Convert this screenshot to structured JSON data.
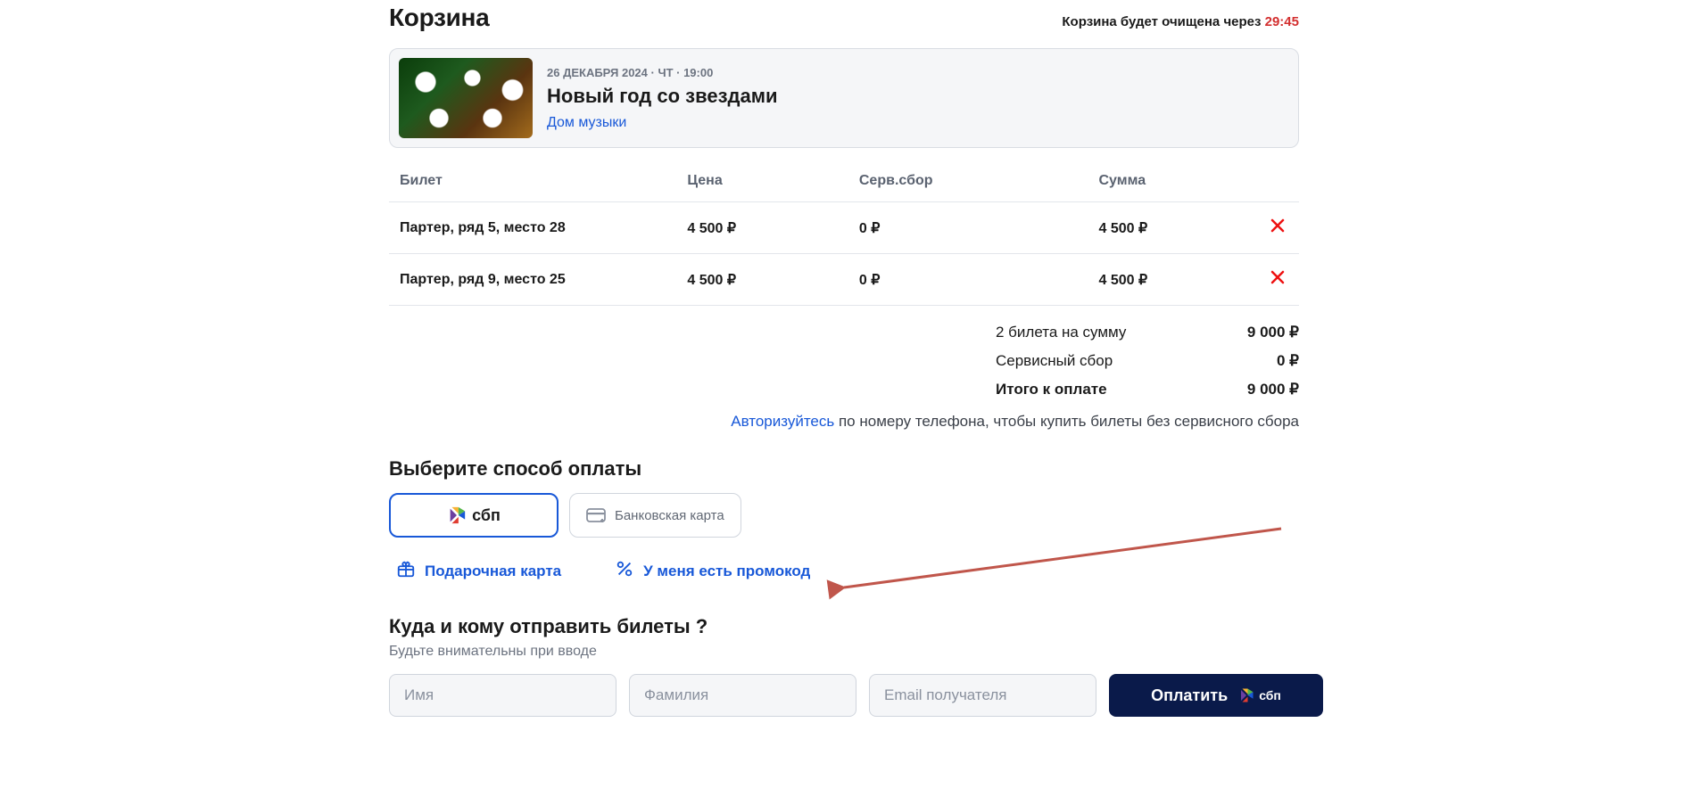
{
  "header": {
    "title": "Корзина",
    "timer_label": "Корзина будет очищена через ",
    "timer_value": "29:45"
  },
  "event": {
    "date_line": "26 ДЕКАБРЯ 2024 · ЧТ · 19:00",
    "title": "Новый год со звездами",
    "venue": "Дом музыки"
  },
  "table": {
    "headers": {
      "ticket": "Билет",
      "price": "Цена",
      "fee": "Серв.сбор",
      "sum": "Сумма"
    },
    "rows": [
      {
        "ticket": "Партер, ряд 5, место 28",
        "price": "4 500 ₽",
        "fee": "0 ₽",
        "sum": "4 500 ₽"
      },
      {
        "ticket": "Партер, ряд 9, место 25",
        "price": "4 500 ₽",
        "fee": "0 ₽",
        "sum": "4 500 ₽"
      }
    ]
  },
  "summary": {
    "count_label": "2 билета на сумму",
    "count_value": "9 000 ₽",
    "fee_label": "Сервисный сбор",
    "fee_value": "0 ₽",
    "total_label": "Итого к оплате",
    "total_value": "9 000 ₽"
  },
  "auth_note": {
    "link": "Авторизуйтесь",
    "text": " по номеру телефона, чтобы купить билеты без сервисного сбора"
  },
  "payment": {
    "title": "Выберите способ оплаты",
    "sbp_label": "сбп",
    "card_label": "Банковская карта",
    "gift_label": "Подарочная карта",
    "promo_label": "У меня есть промокод"
  },
  "delivery": {
    "title": "Куда и кому отправить билеты ?",
    "subtitle": "Будьте внимательны при вводе",
    "first_name_ph": "Имя",
    "last_name_ph": "Фамилия",
    "email_ph": "Email получателя",
    "pay_label": "Оплатить",
    "pay_sbp": "сбп"
  },
  "colors": {
    "link": "#1858d8",
    "danger": "#d32f2f",
    "dark_button": "#0a1a4a"
  }
}
